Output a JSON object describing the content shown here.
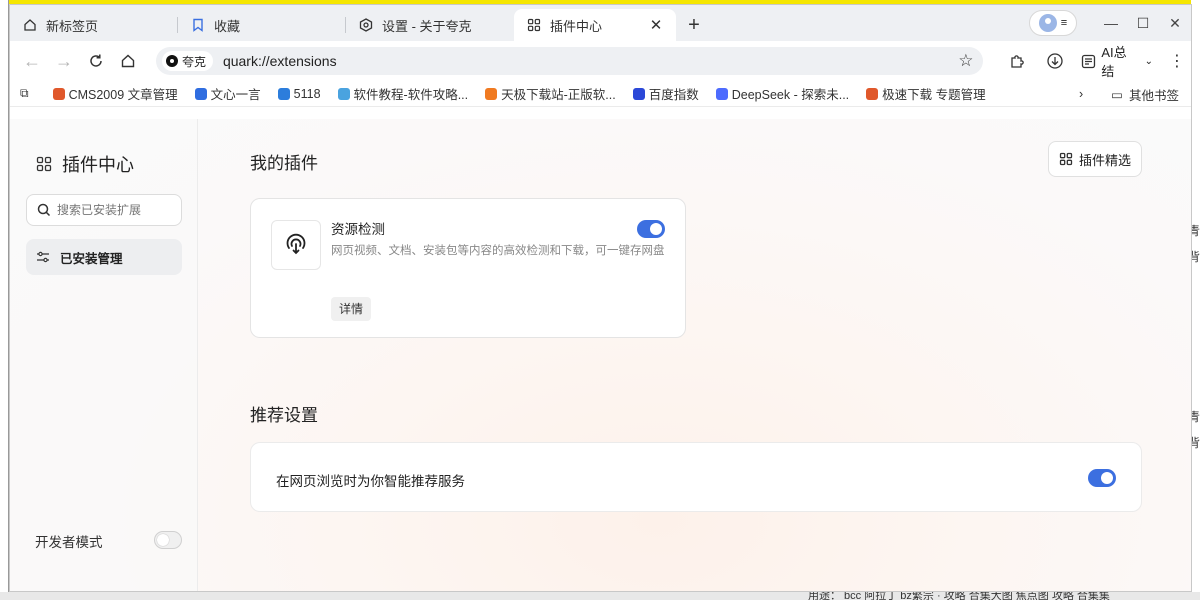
{
  "tabs": [
    {
      "label": "新标签页",
      "icon": "home-icon"
    },
    {
      "label": "收藏",
      "icon": "bookmark-icon"
    },
    {
      "label": "设置 - 关于夸克",
      "icon": "settings-icon"
    },
    {
      "label": "插件中心",
      "icon": "apps-icon",
      "active": true
    }
  ],
  "toolbar": {
    "engine_chip": "夸克",
    "url": "quark://extensions",
    "ai_label": "AI总结"
  },
  "bookmarks": [
    {
      "label": "CMS2009 文章管理",
      "color": "#e0582b"
    },
    {
      "label": "文心一言",
      "color": "#2f6de0"
    },
    {
      "label": "5118",
      "color": "#2c7ddc"
    },
    {
      "label": "软件教程-软件攻略...",
      "color": "#4aa3df"
    },
    {
      "label": "天极下载站-正版软...",
      "color": "#f07a21"
    },
    {
      "label": "百度指数",
      "color": "#2b48d8"
    },
    {
      "label": "DeepSeek - 探索未...",
      "color": "#4d6bfe"
    },
    {
      "label": "极速下载 专题管理",
      "color": "#e0582b"
    }
  ],
  "bookmarks_other": "其他书签",
  "sidebar": {
    "title": "插件中心",
    "search_placeholder": "搜索已安装扩展",
    "item_installed": "已安装管理",
    "dev_mode": "开发者模式"
  },
  "main": {
    "my_plugins_title": "我的插件",
    "pick_button": "插件精选",
    "plugin": {
      "name": "资源检测",
      "description": "网页视频、文档、安装包等内容的高效检测和下载，可一键存网盘",
      "detail": "详情",
      "enabled": true
    },
    "recommend_title": "推荐设置",
    "recommend_label": "在网页浏览时为你智能推荐服务",
    "recommend_enabled": true
  },
  "desktop_bottom_text": "用途： bcc 阿拉丁 bz繁宗 · 攻略 合集大图 焦点图 攻略 合集集",
  "colors": {
    "accent": "#3c6fe0"
  }
}
